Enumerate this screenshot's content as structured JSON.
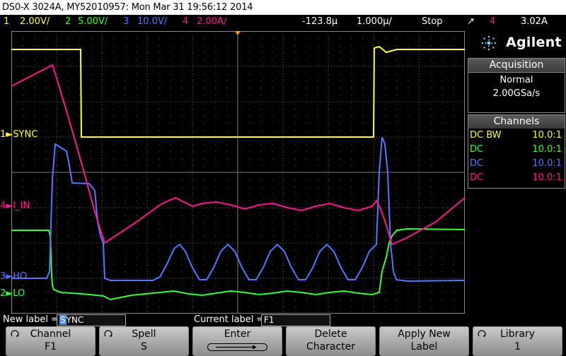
{
  "title": "DS0-X 3024A, MY52010957: Mon Mar 31 19:56:12 2014",
  "status": {
    "ch1_num": "1",
    "ch1_scale": "2.00V/",
    "ch2_num": "2",
    "ch2_scale": "5.00V/",
    "ch3_num": "3",
    "ch3_scale": "10.0V/",
    "ch4_num": "4",
    "ch4_scale": "2.00A/",
    "time_pos": "-123.8µ",
    "time_div": "1.000µ/",
    "run_state": "Stop",
    "trig_source": "4",
    "trig_level": "3.02A"
  },
  "brand": "Agilent",
  "acquisition": {
    "header": "Acquisition",
    "mode": "Normal",
    "rate": "2.00GSa/s"
  },
  "channels": {
    "header": "Channels",
    "rows": [
      {
        "coupling": "DC BW",
        "probe": "10.0:1",
        "color": "#ffff33"
      },
      {
        "coupling": "DC",
        "probe": "10.0:1",
        "color": "#33ff33"
      },
      {
        "coupling": "DC",
        "probe": "10.0:1",
        "color": "#5577ff"
      },
      {
        "coupling": "DC",
        "probe": "10.0:1",
        "color": "#ff1493"
      }
    ]
  },
  "trace_labels": {
    "ch1_num": "1",
    "ch1": "SYNC",
    "ch4_num": "4",
    "ch4": "I_IN",
    "ch3_num": "3",
    "ch3": "HO",
    "ch2_num": "2",
    "ch2": "LO"
  },
  "editline": {
    "new_label_caption": "New label =",
    "new_label_cursor": "S",
    "new_label_rest": "YNC",
    "current_label_caption": "Current label =",
    "current_label_value": "F1"
  },
  "softkeys": [
    {
      "line1": "Channel",
      "line2": "F1"
    },
    {
      "line1": "Spell",
      "line2": "S"
    },
    {
      "line1": "Enter",
      "line2": ""
    },
    {
      "line1": "Delete",
      "line2": "Character"
    },
    {
      "line1": "Apply New",
      "line2": "Label"
    },
    {
      "line1": "Library",
      "line2": "1"
    }
  ],
  "colors": {
    "ch1": "#ffff33",
    "ch2": "#33ff33",
    "ch3": "#5577ff",
    "ch4": "#ff1493",
    "trigger": "#ff9900"
  }
}
